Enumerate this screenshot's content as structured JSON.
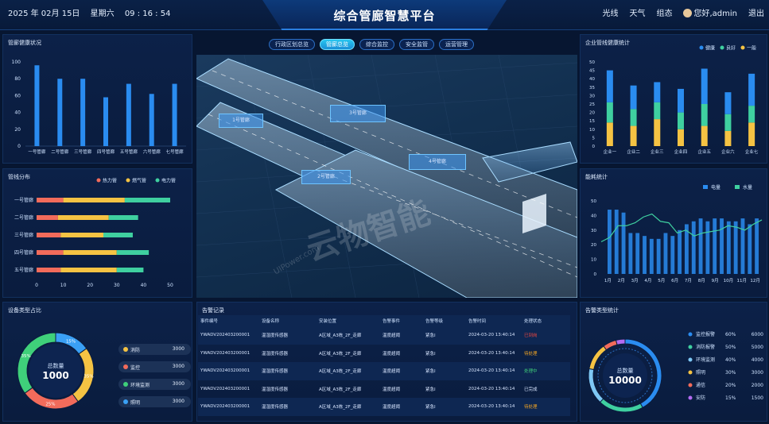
{
  "header": {
    "date": "2025 年 02月 15日",
    "weekday": "星期六",
    "time": "09 : 16 : 54",
    "title": "综合管廊智慧平台",
    "nav": [
      "光线",
      "天气",
      "组态"
    ],
    "user": "您好,admin",
    "logout": "退出"
  },
  "tabs": [
    "行政区划总览",
    "管廊总览",
    "综合监控",
    "安全监管",
    "运营管理"
  ],
  "active_tab": "管廊总览",
  "scene": {
    "labels": [
      "1号管廊",
      "3号管廊",
      "2号管廊",
      "4号管廊"
    ],
    "watermark": "云物智能",
    "watermark_sub": "UIPower.com"
  },
  "health": {
    "title": "管廊健康状况",
    "chart_data": {
      "type": "bar",
      "categories": [
        "一号管廊",
        "二号管廊",
        "三号管廊",
        "四号管廊",
        "五号管廊",
        "六号管廊",
        "七号管廊"
      ],
      "values": [
        96,
        80,
        80,
        58,
        74,
        62,
        74
      ],
      "ylim": [
        0,
        100
      ],
      "yticks": [
        0,
        20,
        40,
        60,
        80,
        100
      ]
    }
  },
  "pipeline": {
    "title": "管线分布",
    "legend": [
      "热力管",
      "燃气管",
      "电力管"
    ],
    "colors": [
      "#f26b5b",
      "#f5c343",
      "#3fd0a0"
    ],
    "chart_data": {
      "type": "bar",
      "categories": [
        "一号管廊",
        "二号管廊",
        "三号管廊",
        "四号管廊",
        "五号管廊"
      ],
      "series": [
        {
          "name": "热力管",
          "values": [
            10,
            8,
            9,
            10,
            9
          ]
        },
        {
          "name": "燃气管",
          "values": [
            23,
            19,
            16,
            20,
            21
          ]
        },
        {
          "name": "电力管",
          "values": [
            17,
            11,
            11,
            12,
            10
          ]
        }
      ],
      "xlim": [
        0,
        50
      ],
      "xticks": [
        0,
        10,
        20,
        30,
        40,
        50
      ]
    }
  },
  "devtype": {
    "title": "设备类型占比",
    "center_label": "总数量",
    "center_value": "1000",
    "slices": [
      {
        "name": "消防",
        "value": 3000,
        "pct": "35%",
        "color": "#f5c343"
      },
      {
        "name": "监控",
        "value": 3000,
        "pct": "25%",
        "color": "#f26b5b"
      },
      {
        "name": "环境监测",
        "value": 3000,
        "pct": "35%",
        "color": "#3fd07a"
      },
      {
        "name": "照明",
        "value": 3000,
        "pct": "15%",
        "color": "#3aa0f5"
      }
    ],
    "chart_data": {
      "type": "pie",
      "categories": [
        "消防",
        "监控",
        "环境监测",
        "照明"
      ],
      "values": [
        25,
        25,
        35,
        15
      ]
    }
  },
  "alarm_records": {
    "title": "告警记录",
    "columns": [
      "事件编号",
      "设备名称",
      "安装位置",
      "告警事件",
      "告警等级",
      "告警时间",
      "处理状态"
    ],
    "rows": [
      [
        "YWADV202403200001",
        "温湿度传感器",
        "A区域_A3栋_2F_走廊",
        "温度超阈",
        "紧急I",
        "2024-03-20 13:40:14",
        "已到岗"
      ],
      [
        "YWADV202403200001",
        "温湿度传感器",
        "A区域_A3栋_2F_走廊",
        "温度超阈",
        "紧急I",
        "2024-03-20 13:40:14",
        "待处理"
      ],
      [
        "YWADV202403200001",
        "温湿度传感器",
        "A区域_A3栋_2F_走廊",
        "温度超阈",
        "紧急I",
        "2024-03-20 13:40:14",
        "处理中"
      ],
      [
        "YWADV202403200001",
        "温湿度传感器",
        "A区域_A3栋_2F_走廊",
        "温度超阈",
        "紧急I",
        "2024-03-20 13:40:14",
        "已完成"
      ],
      [
        "YWADV202403200001",
        "温湿度传感器",
        "A区域_A3栋_2F_走廊",
        "温度超阈",
        "紧急I",
        "2024-03-20 13:40:14",
        "待处理"
      ]
    ],
    "status_colors": {
      "已到岗": "#f2473f",
      "待处理": "#f5a623",
      "处理中": "#3fd07a",
      "已完成": "#d8e6ff"
    }
  },
  "company": {
    "title": "企业管线健康统计",
    "legend": [
      "健康",
      "良好",
      "一般"
    ],
    "colors": [
      "#2a8cf0",
      "#3fd0a0",
      "#f5c343"
    ],
    "chart_data": {
      "type": "bar",
      "categories": [
        "企业一",
        "企业二",
        "企业三",
        "企业四",
        "企业五",
        "企业六",
        "企业七"
      ],
      "series": [
        {
          "name": "健康",
          "values": [
            19,
            14,
            12,
            14,
            21,
            13,
            19
          ]
        },
        {
          "name": "良好",
          "values": [
            12,
            10,
            10,
            10,
            13,
            10,
            10
          ]
        },
        {
          "name": "一般",
          "values": [
            14,
            12,
            16,
            10,
            12,
            9,
            14
          ]
        }
      ],
      "ylim": [
        0,
        50
      ],
      "yticks": [
        0,
        5,
        10,
        15,
        20,
        25,
        30,
        35,
        40,
        45,
        50
      ]
    }
  },
  "energy": {
    "title": "能耗统计",
    "legend": [
      "电量",
      "水量"
    ],
    "chart_data": {
      "type": "bar",
      "categories": [
        "1月",
        "2月",
        "3月",
        "4月",
        "5月",
        "6月",
        "7月",
        "8月",
        "9月",
        "10月",
        "11月",
        "12月"
      ],
      "series": [
        {
          "name": "电量",
          "values": [
            44,
            44,
            42,
            28,
            28,
            26,
            24,
            24,
            28,
            26,
            30,
            34,
            36,
            38,
            36,
            38,
            38,
            36,
            36,
            38,
            34,
            38
          ]
        },
        {
          "name": "水量",
          "values": [
            22,
            25,
            33,
            33,
            35,
            39,
            41,
            36,
            35,
            28,
            30,
            26,
            28,
            29,
            30,
            33,
            32,
            30,
            34,
            37
          ]
        }
      ],
      "ylim": [
        0,
        50
      ],
      "yticks": [
        0,
        10,
        20,
        30,
        40,
        50
      ]
    }
  },
  "alarm_types": {
    "title": "告警类型统计",
    "center_label": "总数量",
    "center_value": "10000",
    "items": [
      {
        "name": "监控报警",
        "pct": "60%",
        "value": "6000",
        "color": "#2a8cf0"
      },
      {
        "name": "消防报警",
        "pct": "50%",
        "value": "5000",
        "color": "#3fd0a0"
      },
      {
        "name": "环境监测",
        "pct": "40%",
        "value": "4000",
        "color": "#7ec8f5"
      },
      {
        "name": "照明",
        "pct": "30%",
        "value": "3000",
        "color": "#f5c343"
      },
      {
        "name": "通信",
        "pct": "20%",
        "value": "2000",
        "color": "#f26b5b"
      },
      {
        "name": "安防",
        "pct": "15%",
        "value": "1500",
        "color": "#b36bf2"
      }
    ]
  }
}
